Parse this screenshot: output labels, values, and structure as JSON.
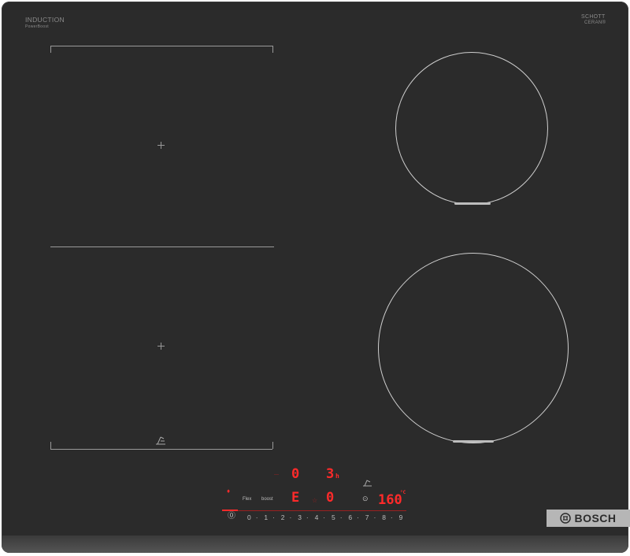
{
  "hob": {
    "label_top_left": "INDUCTION",
    "label_top_left_sub": "PowerBoost",
    "label_top_right": "SCHOTT",
    "label_top_right_2": "CERAN®"
  },
  "controls": {
    "display_top_left": "0",
    "display_top_right": "3",
    "display_top_right_sub": "h",
    "display_mid_left": "E",
    "display_mid_right": "0",
    "display_temp": "160",
    "display_temp_unit": "°C",
    "label_flex": "Flex",
    "label_boost": "boost"
  },
  "power_scale": [
    "0",
    "·",
    "1",
    "·",
    "2",
    "·",
    "3",
    "·",
    "4",
    "·",
    "5",
    "·",
    "6",
    "·",
    "7",
    "·",
    "8",
    "·",
    "9"
  ],
  "brand": {
    "name": "BOSCH"
  },
  "colors": {
    "display_red": "#ff2a2a",
    "glass": "#2b2b2b",
    "brand_bg": "#b6b6b6"
  }
}
